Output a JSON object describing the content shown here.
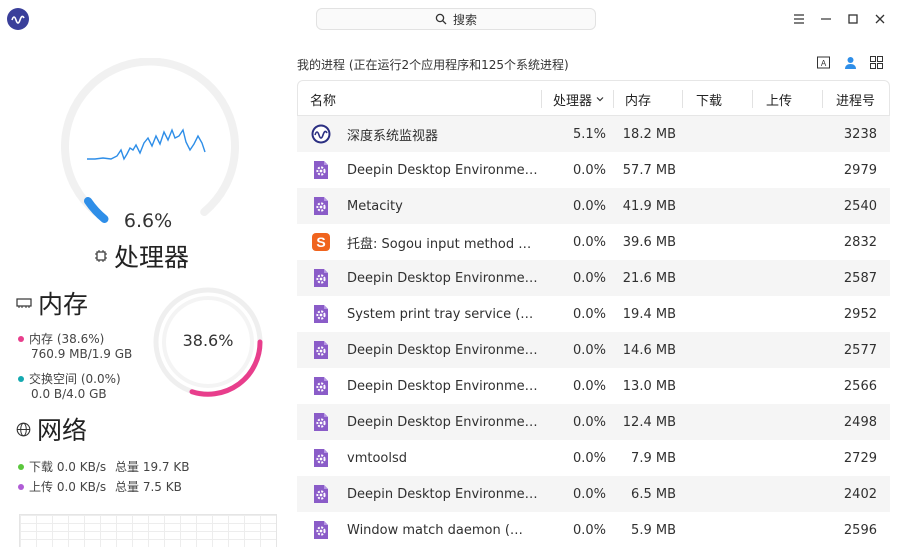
{
  "search": {
    "label": "搜索"
  },
  "cpu": {
    "value": "6.6%",
    "title": "处理器"
  },
  "memory": {
    "title": "内存",
    "gauge_value": "38.6%",
    "mem_label": "内存 (38.6%)",
    "mem_detail": "760.9 MB/1.9 GB",
    "swap_label": "交换空间 (0.0%)",
    "swap_detail": "0.0 B/4.0 GB",
    "mem_color": "#e83e8c",
    "swap_color": "#14a9b0"
  },
  "network": {
    "title": "网络",
    "download_label": "下载 0.0 KB/s",
    "download_total": "总量 19.7 KB",
    "upload_label": "上传 0.0 KB/s",
    "upload_total": "总量 7.5 KB",
    "download_color": "#5bc73d",
    "upload_color": "#b05cd6"
  },
  "summary": "我的进程 (正在运行2个应用程序和125个系统进程)",
  "columns": {
    "name": "名称",
    "cpu": "处理器",
    "memory": "内存",
    "download": "下载",
    "upload": "上传",
    "pid": "进程号"
  },
  "processes": [
    {
      "icon": "monitor-icon",
      "name": "深度系统监视器",
      "cpu": "5.1%",
      "mem": "18.2 MB",
      "pid": "3238"
    },
    {
      "icon": "gear-file-icon",
      "name": "Deepin Desktop Environme…",
      "cpu": "0.0%",
      "mem": "57.7 MB",
      "pid": "2979"
    },
    {
      "icon": "gear-file-icon",
      "name": "Metacity",
      "cpu": "0.0%",
      "mem": "41.9 MB",
      "pid": "2540"
    },
    {
      "icon": "sogou-icon",
      "name": "托盘: Sogou input method …",
      "cpu": "0.0%",
      "mem": "39.6 MB",
      "pid": "2832"
    },
    {
      "icon": "gear-file-icon",
      "name": "Deepin Desktop Environme…",
      "cpu": "0.0%",
      "mem": "21.6 MB",
      "pid": "2587"
    },
    {
      "icon": "gear-file-icon",
      "name": "System print tray service (…",
      "cpu": "0.0%",
      "mem": "19.4 MB",
      "pid": "2952"
    },
    {
      "icon": "gear-file-icon",
      "name": "Deepin Desktop Environme…",
      "cpu": "0.0%",
      "mem": "14.6 MB",
      "pid": "2577"
    },
    {
      "icon": "gear-file-icon",
      "name": "Deepin Desktop Environme…",
      "cpu": "0.0%",
      "mem": "13.0 MB",
      "pid": "2566"
    },
    {
      "icon": "gear-file-icon",
      "name": "Deepin Desktop Environme…",
      "cpu": "0.0%",
      "mem": "12.4 MB",
      "pid": "2498"
    },
    {
      "icon": "gear-file-icon",
      "name": "vmtoolsd",
      "cpu": "0.0%",
      "mem": "7.9 MB",
      "pid": "2729"
    },
    {
      "icon": "gear-file-icon",
      "name": "Deepin Desktop Environme…",
      "cpu": "0.0%",
      "mem": "6.5 MB",
      "pid": "2402"
    },
    {
      "icon": "gear-file-icon",
      "name": "Window match daemon (…",
      "cpu": "0.0%",
      "mem": "5.9 MB",
      "pid": "2596"
    }
  ]
}
